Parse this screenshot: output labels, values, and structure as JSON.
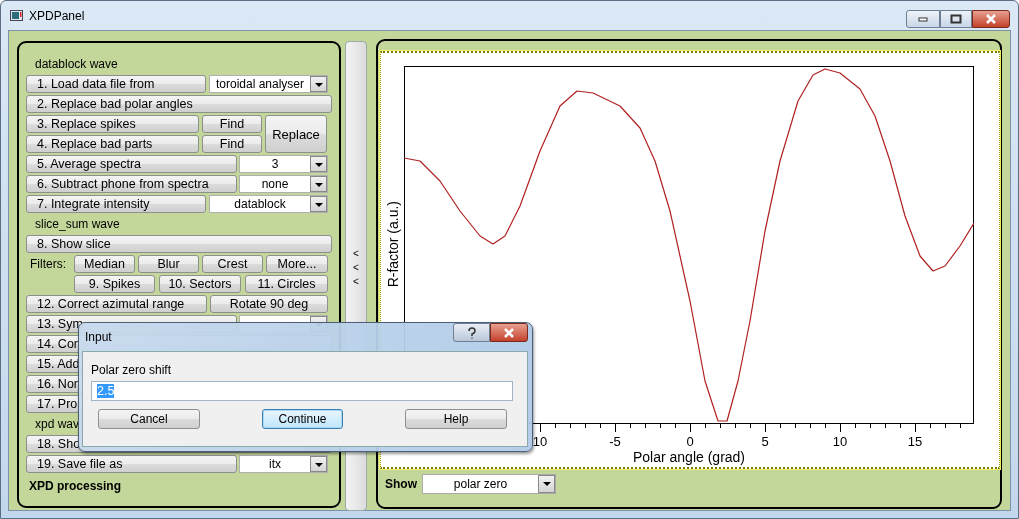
{
  "window": {
    "title": "XPDPanel"
  },
  "left_panel": {
    "rows": [
      {
        "kind": "heading",
        "text": "datablock wave"
      },
      {
        "kind": "widechoice",
        "label": "1. Load data file from",
        "dropdown": "toroidal analyser"
      },
      {
        "kind": "button",
        "label": "2. Replace bad polar angles"
      },
      {
        "kind": "findpair",
        "items": [
          {
            "label": "3. Replace spikes",
            "find": "Find"
          },
          {
            "label": "4. Replace bad parts",
            "find": "Find"
          }
        ],
        "replace": "Replace"
      },
      {
        "kind": "choice",
        "label": "5. Average spectra",
        "dropdown": "3"
      },
      {
        "kind": "choice",
        "label": "6. Subtract phone from spectra",
        "dropdown": "none"
      },
      {
        "kind": "widechoice",
        "label": "7. Integrate intensity",
        "dropdown": "datablock"
      },
      {
        "kind": "heading",
        "text": "slice_sum wave"
      },
      {
        "kind": "button",
        "label": "8. Show slice"
      },
      {
        "kind": "filters",
        "label": "Filters:",
        "buttons": [
          "Median",
          "Blur",
          "Crest",
          "More..."
        ]
      },
      {
        "kind": "buttons",
        "buttons": [
          "9. Spikes",
          "10. Sectors",
          "11. Circles"
        ]
      },
      {
        "kind": "pair",
        "buttons": [
          "12. Correct azimutal range",
          "Rotate 90 deg"
        ]
      },
      {
        "kind": "choice",
        "label": "13. Sym"
      },
      {
        "kind": "button",
        "label": "14. Cor"
      },
      {
        "kind": "button",
        "label": "15. Add"
      },
      {
        "kind": "button",
        "label": "16. Nor"
      },
      {
        "kind": "button",
        "label": "17. Pro"
      },
      {
        "kind": "heading",
        "text": "xpd wav"
      },
      {
        "kind": "button",
        "label": "18. Sho"
      },
      {
        "kind": "choice",
        "label": "19. Save file as",
        "dropdown": "itx"
      }
    ],
    "footer": "XPD processing"
  },
  "splitter": {
    "arrows": [
      "<",
      "<",
      "<"
    ]
  },
  "plot": {
    "y_label": "R-factor (a.u.)",
    "x_label": "Polar angle (grad)",
    "x_tick_labels": [
      "10",
      "-5",
      "0",
      "5",
      "10",
      "15"
    ]
  },
  "show": {
    "label": "Show",
    "value": "polar zero"
  },
  "dialog": {
    "title": "Input",
    "prompt": "Polar zero shift",
    "value": "2.5",
    "value_selected": true,
    "buttons": [
      {
        "label": "Cancel",
        "default": false
      },
      {
        "label": "Continue",
        "default": true
      },
      {
        "label": "Help",
        "default": false
      }
    ]
  }
}
